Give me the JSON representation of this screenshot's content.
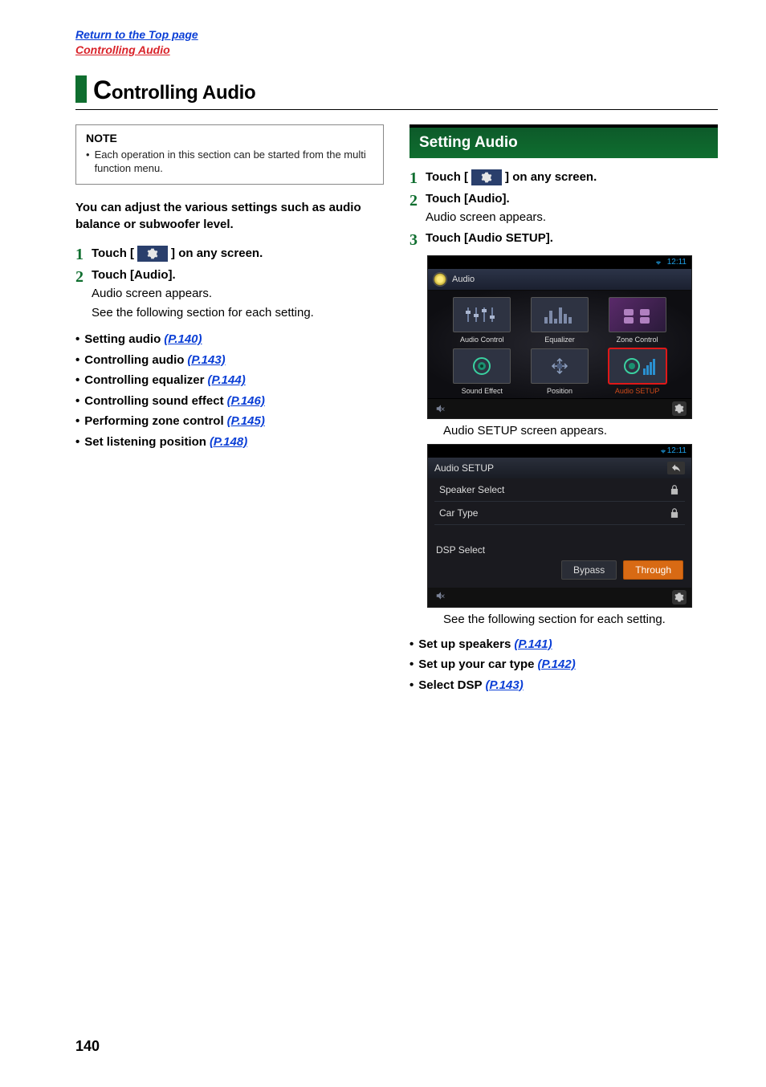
{
  "top_links": {
    "line1": "Return to the Top page",
    "line2": "Controlling Audio"
  },
  "chapter_title_big": "C",
  "chapter_title_rest": "ontrolling Audio",
  "left": {
    "note_heading": "NOTE",
    "note_item": "Each operation in this section can be started from the multi function menu.",
    "intro": "You can adjust the various settings such as audio balance or subwoofer level.",
    "step1_pre": "Touch [",
    "step1_post": "] on any screen.",
    "step2_title": "Touch [Audio].",
    "step2_sub1": "Audio screen appears.",
    "step2_sub2": "See the following section for each setting.",
    "bullets": [
      {
        "t": "Setting audio",
        "p": "(P.140)"
      },
      {
        "t": "Controlling audio",
        "p": "(P.143)"
      },
      {
        "t": "Controlling equalizer",
        "p": "(P.144)"
      },
      {
        "t": "Controlling sound effect",
        "p": "(P.146)"
      },
      {
        "t": "Performing zone control",
        "p": "(P.145)"
      },
      {
        "t": "Set listening position",
        "p": "(P.148)"
      }
    ]
  },
  "right": {
    "section_title": "Setting Audio",
    "step1_pre": "Touch [",
    "step1_post": "] on any screen.",
    "step2_title": "Touch [Audio].",
    "step2_sub": "Audio screen appears.",
    "step3_title": "Touch [Audio SETUP].",
    "shot1": {
      "clock": "12:11",
      "breadcrumb": "Audio",
      "items": [
        {
          "label": "Audio Control"
        },
        {
          "label": "Equalizer"
        },
        {
          "label": "Zone Control"
        },
        {
          "label": "Sound Effect"
        },
        {
          "label": "Position"
        },
        {
          "label": "Audio SETUP"
        }
      ]
    },
    "shot1_caption": "Audio SETUP screen appears.",
    "shot2": {
      "clock": "12:11",
      "title": "Audio SETUP",
      "row1": "Speaker Select",
      "row2": "Car Type",
      "dsp_label": "DSP Select",
      "btn_bypass": "Bypass",
      "btn_through": "Through"
    },
    "shot2_caption": "See the following section for each setting.",
    "bullets2": [
      {
        "t": "Set up speakers",
        "p": "(P.141)"
      },
      {
        "t": "Set up your car type",
        "p": "(P.142)"
      },
      {
        "t": "Select DSP",
        "p": "(P.143)"
      }
    ]
  },
  "page_number": "140"
}
